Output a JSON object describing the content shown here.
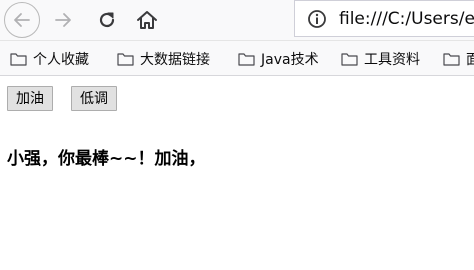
{
  "url": "file:///C:/Users/e",
  "bookmarks": [
    {
      "label": "个人收藏"
    },
    {
      "label": "大数据链接"
    },
    {
      "label": "Java技术"
    },
    {
      "label": "工具资料"
    },
    {
      "label": "面"
    }
  ],
  "buttons": {
    "increase": "加油",
    "decrease": "低调"
  },
  "message": "小强，你最棒~~！加油，"
}
